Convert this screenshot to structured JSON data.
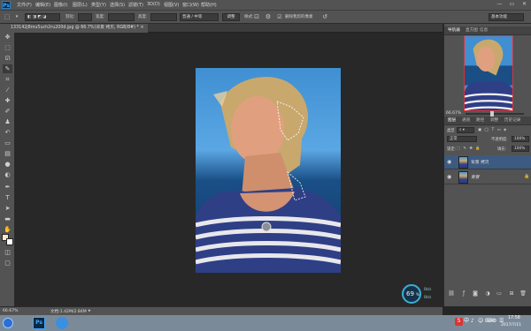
{
  "app": {
    "logo": "Ps"
  },
  "menu": [
    "文件(F)",
    "编辑(E)",
    "图像(I)",
    "图层(L)",
    "类型(Y)",
    "选择(S)",
    "滤镜(T)",
    "3D(D)",
    "视图(V)",
    "窗口(W)",
    "帮助(H)"
  ],
  "window_controls": {
    "minimize": "—",
    "restore": "▭",
    "close": "✕"
  },
  "options_bar": {
    "feather_label": "羽化:",
    "feather_value": "",
    "style_label": "样式:",
    "style_value": "正常",
    "width_label": "宽度:",
    "height_label": "高度:",
    "refine_button": "调整边缘...",
    "quality_value": "普通 / 中等",
    "antialias_label": "删除我剪的像素",
    "workspace": "基本功能"
  },
  "document_tab": {
    "title": "133142j8mu5uch2ru200d.jpg @ 66.7%(背景 拷贝, RGB/8#) *",
    "close": "×"
  },
  "tools": [
    "move-tool",
    "marquee-tool",
    "lasso-tool",
    "quick-select-tool",
    "crop-tool",
    "eyedropper-tool",
    "healing-tool",
    "brush-tool",
    "stamp-tool",
    "history-brush-tool",
    "eraser-tool",
    "gradient-tool",
    "blur-tool",
    "dodge-tool",
    "pen-tool",
    "type-tool",
    "path-select-tool",
    "shape-tool",
    "hand-tool",
    "zoom-tool"
  ],
  "colors": {
    "foreground": "#f5e7c8",
    "background": "#ffffff",
    "accent": "#2d6cdf",
    "panel": "#535353"
  },
  "navigator": {
    "tabs": [
      "导航器",
      "直方图",
      "信息"
    ],
    "zoom": "66.67%"
  },
  "layers_panel": {
    "tabs": [
      "图层",
      "通道",
      "路径",
      "调整",
      "历史记录"
    ],
    "kind_label": "类型",
    "blend_mode": "正常",
    "opacity_label": "不透明度:",
    "opacity_value": "100%",
    "lock_label": "锁定:",
    "fill_label": "填充:",
    "fill_value": "100%",
    "layers": [
      {
        "name": "背景 拷贝",
        "selected": true
      },
      {
        "name": "背景",
        "selected": false
      }
    ]
  },
  "zoom_widget": {
    "value": "69",
    "unit": "%",
    "up": "0k/s",
    "down": "0k/s"
  },
  "status": {
    "zoom": "66.67%",
    "doc_info": "文档:1.42M/2.84M"
  },
  "taskbar": {
    "time": "17:58",
    "date": "2017/7/11",
    "tray_items": [
      "S",
      "中",
      "♪",
      "☺",
      "⌨",
      "⚙",
      "☰"
    ]
  }
}
